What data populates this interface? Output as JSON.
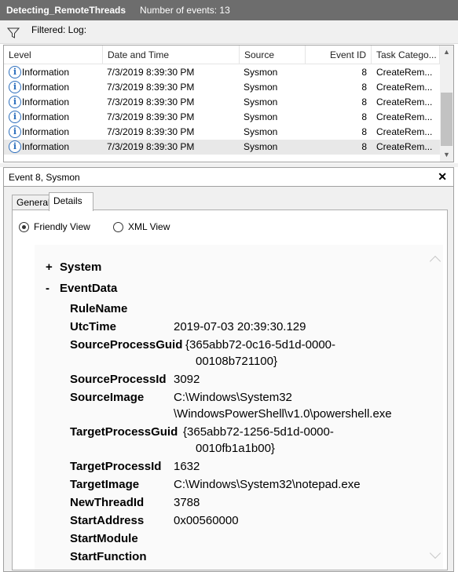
{
  "titlebar": {
    "name": "Detecting_RemoteThreads",
    "count": "Number of events: 13"
  },
  "filter": {
    "text": "Filtered: Log:"
  },
  "grid": {
    "columns": [
      "Level",
      "Date and Time",
      "Source",
      "Event ID",
      "Task Catego..."
    ],
    "rows": [
      {
        "level": "Information",
        "date": "7/3/2019 8:39:30 PM",
        "source": "Sysmon",
        "event_id": "8",
        "task": "CreateRem..."
      },
      {
        "level": "Information",
        "date": "7/3/2019 8:39:30 PM",
        "source": "Sysmon",
        "event_id": "8",
        "task": "CreateRem..."
      },
      {
        "level": "Information",
        "date": "7/3/2019 8:39:30 PM",
        "source": "Sysmon",
        "event_id": "8",
        "task": "CreateRem..."
      },
      {
        "level": "Information",
        "date": "7/3/2019 8:39:30 PM",
        "source": "Sysmon",
        "event_id": "8",
        "task": "CreateRem..."
      },
      {
        "level": "Information",
        "date": "7/3/2019 8:39:30 PM",
        "source": "Sysmon",
        "event_id": "8",
        "task": "CreateRem..."
      },
      {
        "level": "Information",
        "date": "7/3/2019 8:39:30 PM",
        "source": "Sysmon",
        "event_id": "8",
        "task": "CreateRem..."
      }
    ],
    "selected_row": 5
  },
  "detail": {
    "title": "Event 8, Sysmon",
    "close": "✕",
    "tabs": [
      "General",
      "Details"
    ],
    "active_tab": "Details",
    "views": {
      "friendly": "Friendly View",
      "xml": "XML View",
      "selected": "friendly"
    },
    "system": {
      "sign": "+",
      "label": "System"
    },
    "eventdata": {
      "sign": "-",
      "label": "EventData"
    },
    "fields": [
      {
        "key": "RuleName",
        "value": []
      },
      {
        "key": "UtcTime",
        "value": [
          "2019-07-03 20:39:30.129"
        ]
      },
      {
        "key": "SourceProcessGuid",
        "value": [
          "{365abb72-0c16-5d1d-0000-",
          "00108b721100}"
        ]
      },
      {
        "key": "SourceProcessId",
        "value": [
          "3092"
        ]
      },
      {
        "key": "SourceImage",
        "value": [
          "C:\\Windows\\System32",
          "\\WindowsPowerShell\\v1.0\\powershell.exe"
        ]
      },
      {
        "key": "TargetProcessGuid",
        "value": [
          "{365abb72-1256-5d1d-0000-",
          "0010fb1a1b00}"
        ]
      },
      {
        "key": "TargetProcessId",
        "value": [
          "1632"
        ]
      },
      {
        "key": "TargetImage",
        "value": [
          "C:\\Windows\\System32\\notepad.exe"
        ]
      },
      {
        "key": "NewThreadId",
        "value": [
          "3788"
        ]
      },
      {
        "key": "StartAddress",
        "value": [
          "0x00560000"
        ]
      },
      {
        "key": "StartModule",
        "value": []
      },
      {
        "key": "StartFunction",
        "value": []
      }
    ]
  },
  "colors": {
    "titlebar_bg": "#6d6d6d",
    "info_icon": "#2c6ebd",
    "selected_row_bg": "#e8e8e8"
  }
}
